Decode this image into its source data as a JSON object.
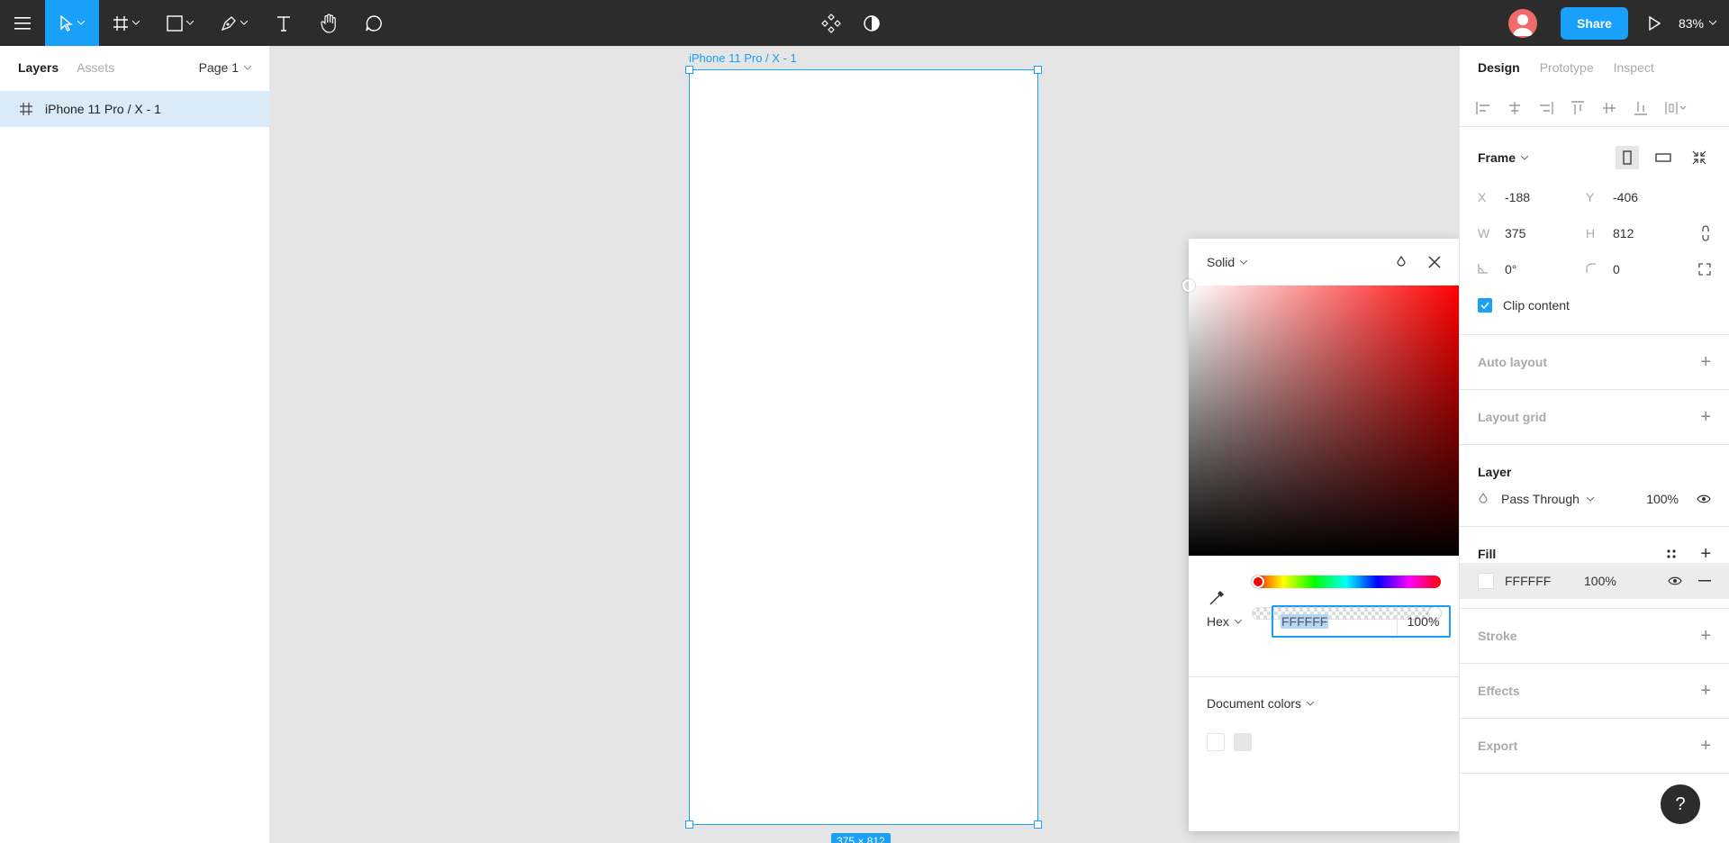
{
  "toolbar": {
    "zoom": "83%",
    "share_label": "Share",
    "accent": "#18a0fb",
    "bg": "#2c2c2c"
  },
  "left_panel": {
    "tabs": [
      {
        "label": "Layers",
        "active": true
      },
      {
        "label": "Assets",
        "active": false
      }
    ],
    "page": "Page 1",
    "layers": [
      {
        "label": "iPhone 11 Pro / X - 1",
        "selected": true
      }
    ]
  },
  "canvas": {
    "frame_label": "iPhone 11 Pro / X - 1",
    "size_badge": "375 × 812"
  },
  "color_picker": {
    "mode": "Solid",
    "format": "Hex",
    "hex": "FFFFFF",
    "opacity": "100%",
    "document_colors_label": "Document colors",
    "document_colors": [
      "#ffffff",
      "#e5e5e5"
    ],
    "hue_color": "#ff0000"
  },
  "right_panel": {
    "tabs": [
      {
        "label": "Design",
        "active": true
      },
      {
        "label": "Prototype",
        "active": false
      },
      {
        "label": "Inspect",
        "active": false
      }
    ],
    "frame": {
      "title": "Frame",
      "x_label": "X",
      "x": "-188",
      "y_label": "Y",
      "y": "-406",
      "w_label": "W",
      "w": "375",
      "h_label": "H",
      "h": "812",
      "rotation": "0°",
      "radius": "0",
      "clip_content": "Clip content"
    },
    "auto_layout": "Auto layout",
    "layout_grid": "Layout grid",
    "layer": {
      "title": "Layer",
      "blend": "Pass Through",
      "opacity": "100%"
    },
    "fill": {
      "title": "Fill",
      "hex": "FFFFFF",
      "opacity": "100%"
    },
    "stroke": "Stroke",
    "effects": "Effects",
    "export": "Export",
    "help": "?"
  }
}
